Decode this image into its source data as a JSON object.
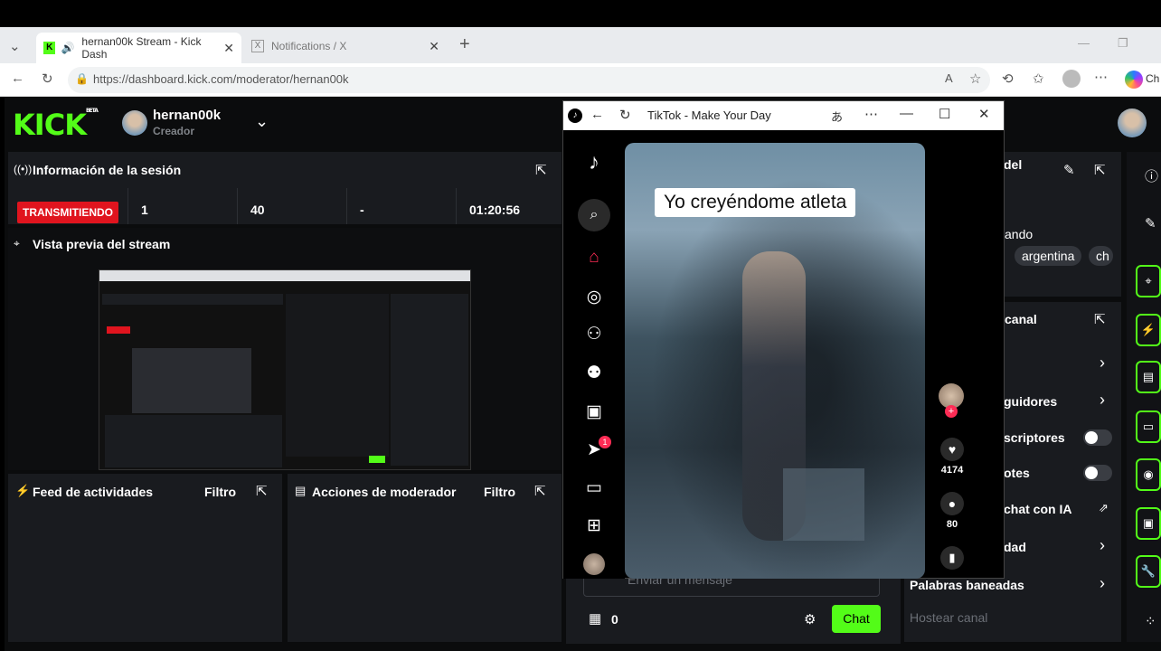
{
  "browser": {
    "tabs": [
      {
        "label": "hernan00k Stream - Kick Dash"
      },
      {
        "label": "Notifications / X"
      }
    ],
    "url": "https://dashboard.kick.com/moderator/hernan00k",
    "extra_label": "Ch"
  },
  "kick": {
    "logo": "KICK",
    "logo_beta": "BETA",
    "user": {
      "name": "hernan00k",
      "role": "Creador"
    },
    "session": {
      "title": "Información de la sesión",
      "status": "TRANSMITIENDO",
      "stats": [
        "1",
        "40",
        "-",
        "01:20:56"
      ]
    },
    "preview": {
      "title": "Vista previa del stream"
    },
    "feed": {
      "title": "Feed de actividades",
      "filter": "Filtro"
    },
    "mod_actions": {
      "title": "Acciones de moderador",
      "filter": "Filtro"
    },
    "chat": {
      "placeholder": "Enviar un mensaje",
      "count": "0",
      "send_label": "Chat"
    },
    "right_panel": {
      "title_partial": "del",
      "item_partial": "ando",
      "tags": [
        "argentina",
        "ch"
      ],
      "canal_title": "canal",
      "rows": [
        {
          "label": "",
          "type": "chevron"
        },
        {
          "label": "guidores",
          "type": "chevron"
        },
        {
          "label": "scriptores",
          "type": "toggle"
        },
        {
          "label": "otes",
          "type": "toggle"
        },
        {
          "label": "chat con IA",
          "type": "external"
        },
        {
          "label": "dad",
          "type": "chevron"
        },
        {
          "label": "Palabras baneadas",
          "type": "chevron"
        },
        {
          "label": "Hostear canal",
          "type": "none"
        }
      ]
    }
  },
  "tiktok": {
    "window_title": "TikTok - Make Your Day",
    "caption": "Yo creyéndome atleta",
    "likes": "4174",
    "comments": "80",
    "notification_badge": "1",
    "sidebar_icons": [
      "tiktok-logo-icon",
      "search-icon",
      "home-icon",
      "explore-icon",
      "following-icon",
      "friends-icon",
      "live-icon",
      "messages-icon",
      "inbox-icon",
      "upload-icon",
      "profile-avatar"
    ]
  },
  "colors": {
    "kick_green": "#53fc18",
    "live_red": "#e0141e",
    "tiktok_pink": "#fe2c55"
  }
}
